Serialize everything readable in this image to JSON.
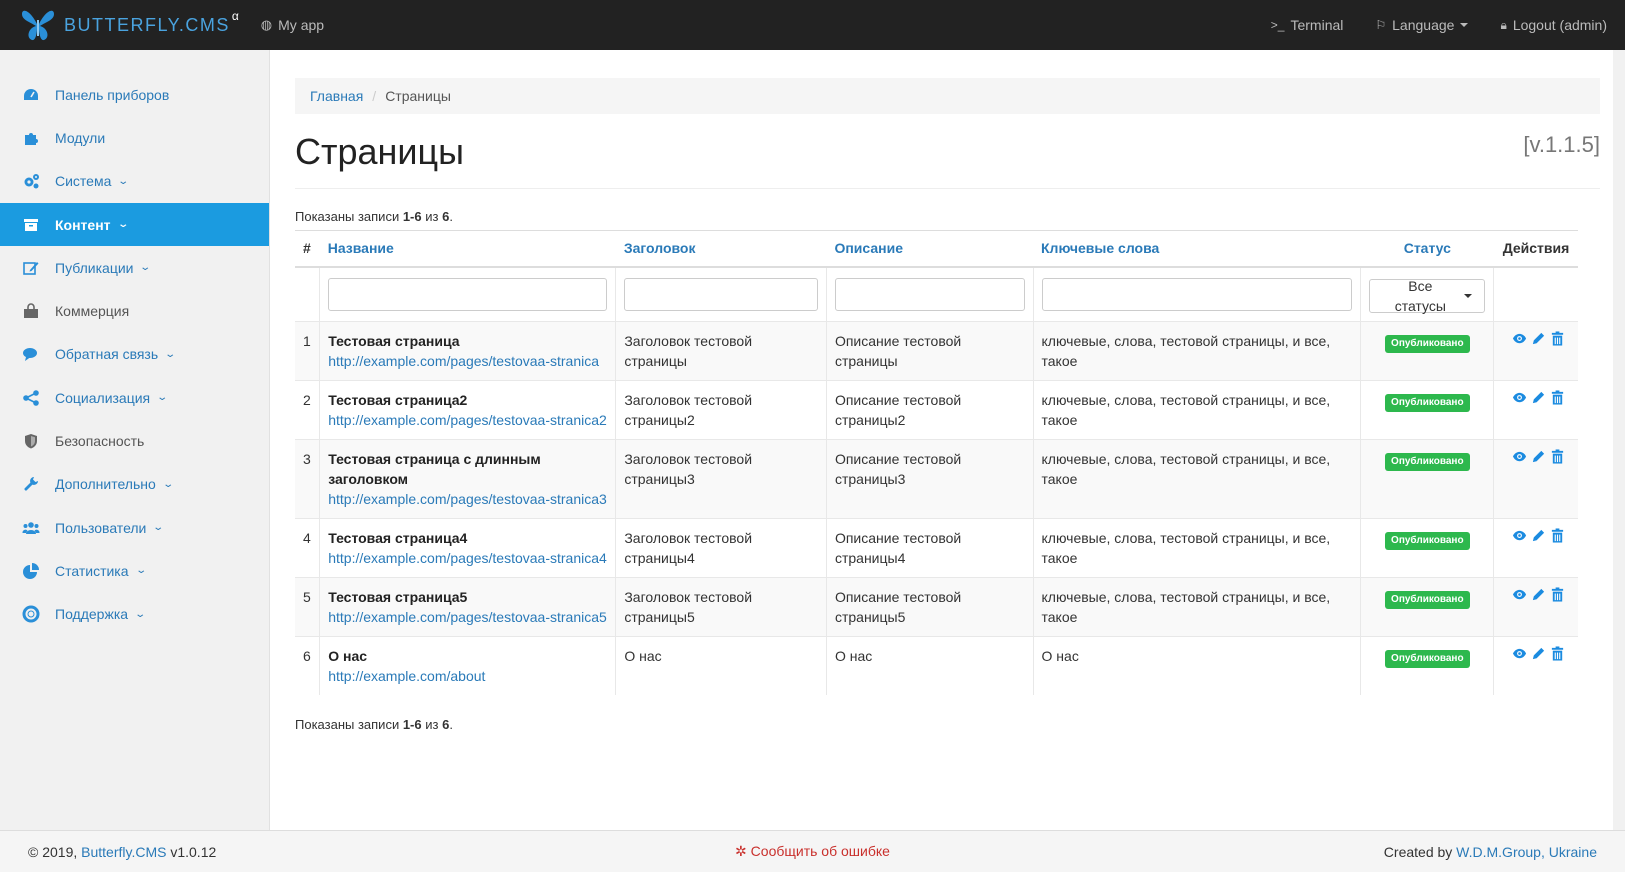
{
  "navbar": {
    "brand": "BUTTERFLY.CMS",
    "brand_sup": "α",
    "app_label": "My app",
    "terminal_label": "Terminal",
    "terminal_icon": ">_",
    "language_label": "Language",
    "logout_label": "Logout (admin)"
  },
  "sidebar": {
    "items": [
      {
        "label": "Панель приборов",
        "icon": "dashboard-icon"
      },
      {
        "label": "Модули",
        "icon": "puzzle-icon"
      },
      {
        "label": "Система",
        "icon": "gears-icon",
        "chevron": "⌄"
      },
      {
        "label": "Контент",
        "icon": "archive-icon",
        "chevron": "⌄",
        "active": true
      },
      {
        "label": "Публикации",
        "icon": "edit-icon",
        "chevron": "⌄"
      },
      {
        "label": "Коммерция",
        "icon": "shopping-bag-icon"
      },
      {
        "label": "Обратная связь",
        "icon": "comments-icon",
        "chevron": "⌄"
      },
      {
        "label": "Социализация",
        "icon": "share-icon",
        "chevron": "⌄"
      },
      {
        "label": "Безопасность",
        "icon": "shield-icon"
      },
      {
        "label": "Дополнительно",
        "icon": "wrench-icon",
        "chevron": "⌄"
      },
      {
        "label": "Пользователи",
        "icon": "users-icon",
        "chevron": "⌄"
      },
      {
        "label": "Статистика",
        "icon": "pie-chart-icon",
        "chevron": "⌄"
      },
      {
        "label": "Поддержка",
        "icon": "lifebuoy-icon",
        "chevron": "⌄"
      }
    ]
  },
  "breadcrumb": {
    "home": "Главная",
    "sep": "/",
    "current": "Страницы"
  },
  "page": {
    "title": "Страницы",
    "version": "[v.1.1.5]"
  },
  "summary": {
    "prefix": "Показаны записи ",
    "range": "1-6",
    "mid": " из ",
    "total": "6",
    "suffix": "."
  },
  "table": {
    "headers": {
      "num": "#",
      "name": "Название",
      "heading": "Заголовок",
      "description": "Описание",
      "keywords": "Ключевые слова",
      "status": "Статус",
      "actions": "Действия"
    },
    "status_filter": "Все статусы",
    "rows": [
      {
        "num": "1",
        "name": "Тестовая страница",
        "url": "http://example.com/pages/testovaa-stranica",
        "heading": "Заголовок тестовой страницы",
        "description": "Описание тестовой страницы",
        "keywords": "ключевые, слова, тестовой страницы, и все, такое",
        "status": "Опубликовано"
      },
      {
        "num": "2",
        "name": "Тестовая страница2",
        "url": "http://example.com/pages/testovaa-stranica2",
        "heading": "Заголовок тестовой страницы2",
        "description": "Описание тестовой страницы2",
        "keywords": "ключевые, слова, тестовой страницы, и все, такое",
        "status": "Опубликовано"
      },
      {
        "num": "3",
        "name": "Тестовая страница с длинным заголовком",
        "url": "http://example.com/pages/testovaa-stranica3",
        "heading": "Заголовок тестовой страницы3",
        "description": "Описание тестовой страницы3",
        "keywords": "ключевые, слова, тестовой страницы, и все, такое",
        "status": "Опубликовано"
      },
      {
        "num": "4",
        "name": "Тестовая страница4",
        "url": "http://example.com/pages/testovaa-stranica4",
        "heading": "Заголовок тестовой страницы4",
        "description": "Описание тестовой страницы4",
        "keywords": "ключевые, слова, тестовой страницы, и все, такое",
        "status": "Опубликовано"
      },
      {
        "num": "5",
        "name": "Тестовая страница5",
        "url": "http://example.com/pages/testovaa-stranica5",
        "heading": "Заголовок тестовой страницы5",
        "description": "Описание тестовой страницы5",
        "keywords": "ключевые, слова, тестовой страницы, и все, такое",
        "status": "Опубликовано"
      },
      {
        "num": "6",
        "name": "О нас",
        "url": "http://example.com/about",
        "heading": "О нас",
        "description": "О нас",
        "keywords": "О нас",
        "status": "Опубликовано"
      }
    ]
  },
  "footer": {
    "copy_prefix": "© 2019, ",
    "cms_link": "Butterfly.CMS",
    "cms_version": " v1.0.12",
    "report_bug": "Сообщить об ошибке",
    "created_prefix": "Created by ",
    "created_link": "W.D.M.Group, Ukraine"
  },
  "colors": {
    "accent": "#1b9be0",
    "link": "#2a7ab8",
    "badge": "#2db84d",
    "navbar": "#222222"
  }
}
